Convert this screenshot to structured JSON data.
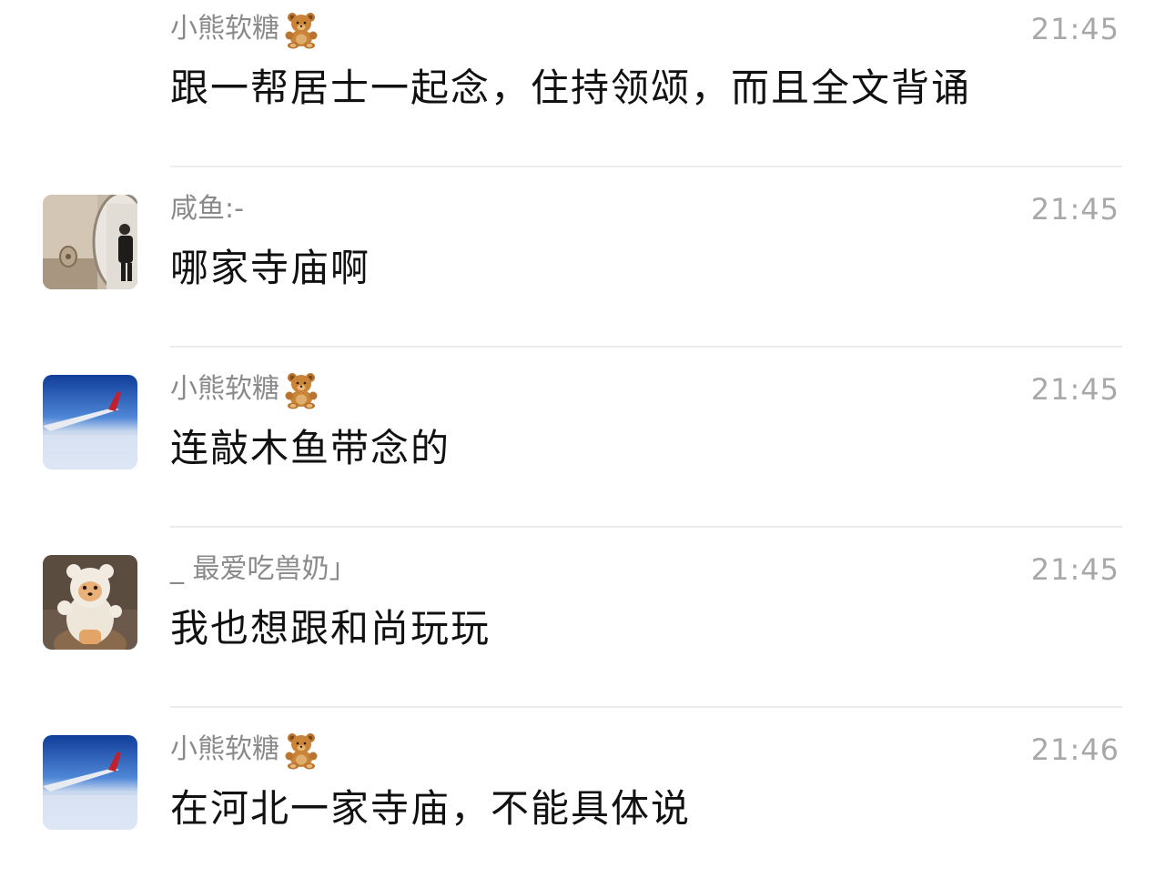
{
  "messages": [
    {
      "sender": "小熊软糖",
      "sender_icon": "teddy-bear-emoji",
      "time": "21:45",
      "text": "跟一帮居士一起念，住持领颂，而且全文背诵",
      "avatar": "none"
    },
    {
      "sender": "咸鱼:-",
      "sender_icon": "",
      "time": "21:45",
      "text": "哪家寺庙啊",
      "avatar": "mirror-photo-avatar"
    },
    {
      "sender": "小熊软糖",
      "sender_icon": "teddy-bear-emoji",
      "time": "21:45",
      "text": "连敲木鱼带念的",
      "avatar": "airplane-wing-avatar"
    },
    {
      "sender": "_ 最爱吃兽奶」",
      "sender_icon": "",
      "time": "21:45",
      "text": "我也想跟和尚玩玩",
      "avatar": "cartoon-bear-avatar"
    },
    {
      "sender": "小熊软糖",
      "sender_icon": "teddy-bear-emoji",
      "time": "21:46",
      "text": "在河北一家寺庙，不能具体说",
      "avatar": "airplane-wing-avatar"
    }
  ],
  "colors": {
    "sender": "#8a8a8a",
    "time": "#a8a8a8",
    "text": "#111111",
    "divider": "#ececec"
  }
}
